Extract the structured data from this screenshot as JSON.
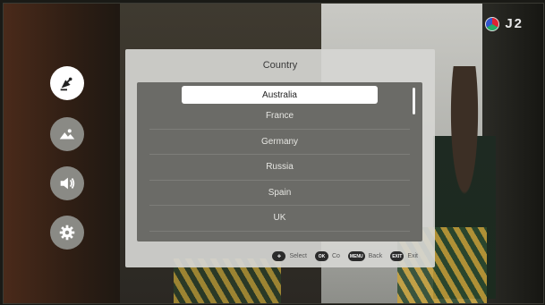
{
  "logo": {
    "text": "J2"
  },
  "side_menu": [
    {
      "name": "satellite-icon",
      "active": true
    },
    {
      "name": "picture-icon",
      "active": false
    },
    {
      "name": "volume-icon",
      "active": false
    },
    {
      "name": "settings-gear-icon",
      "active": false
    }
  ],
  "dialog": {
    "title": "Country",
    "items": [
      "Australia",
      "France",
      "Germany",
      "Russia",
      "Spain",
      "UK"
    ],
    "selected_index": 0
  },
  "hints": {
    "select_label": "Select",
    "ok_button": "OK",
    "confirm_label": "Co",
    "menu_button": "MENU",
    "back_label": "Back",
    "exit_button": "EXIT",
    "exit_label": "Exit"
  }
}
